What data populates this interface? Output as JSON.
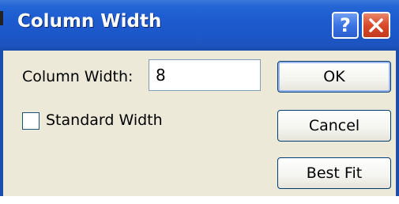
{
  "window": {
    "title": "Column Width",
    "help_label": "?",
    "help_icon": "question-mark-icon",
    "close_icon": "close-x-icon",
    "titlebar_color": "#1d5bd0",
    "close_color": "#d94a2a"
  },
  "form": {
    "column_width_label": "Column Width:",
    "column_width_value": "8",
    "standard_width_label": "Standard Width",
    "standard_width_checked": false
  },
  "buttons": {
    "ok_label": "OK",
    "cancel_label": "Cancel",
    "best_fit_label": "Best Fit"
  }
}
